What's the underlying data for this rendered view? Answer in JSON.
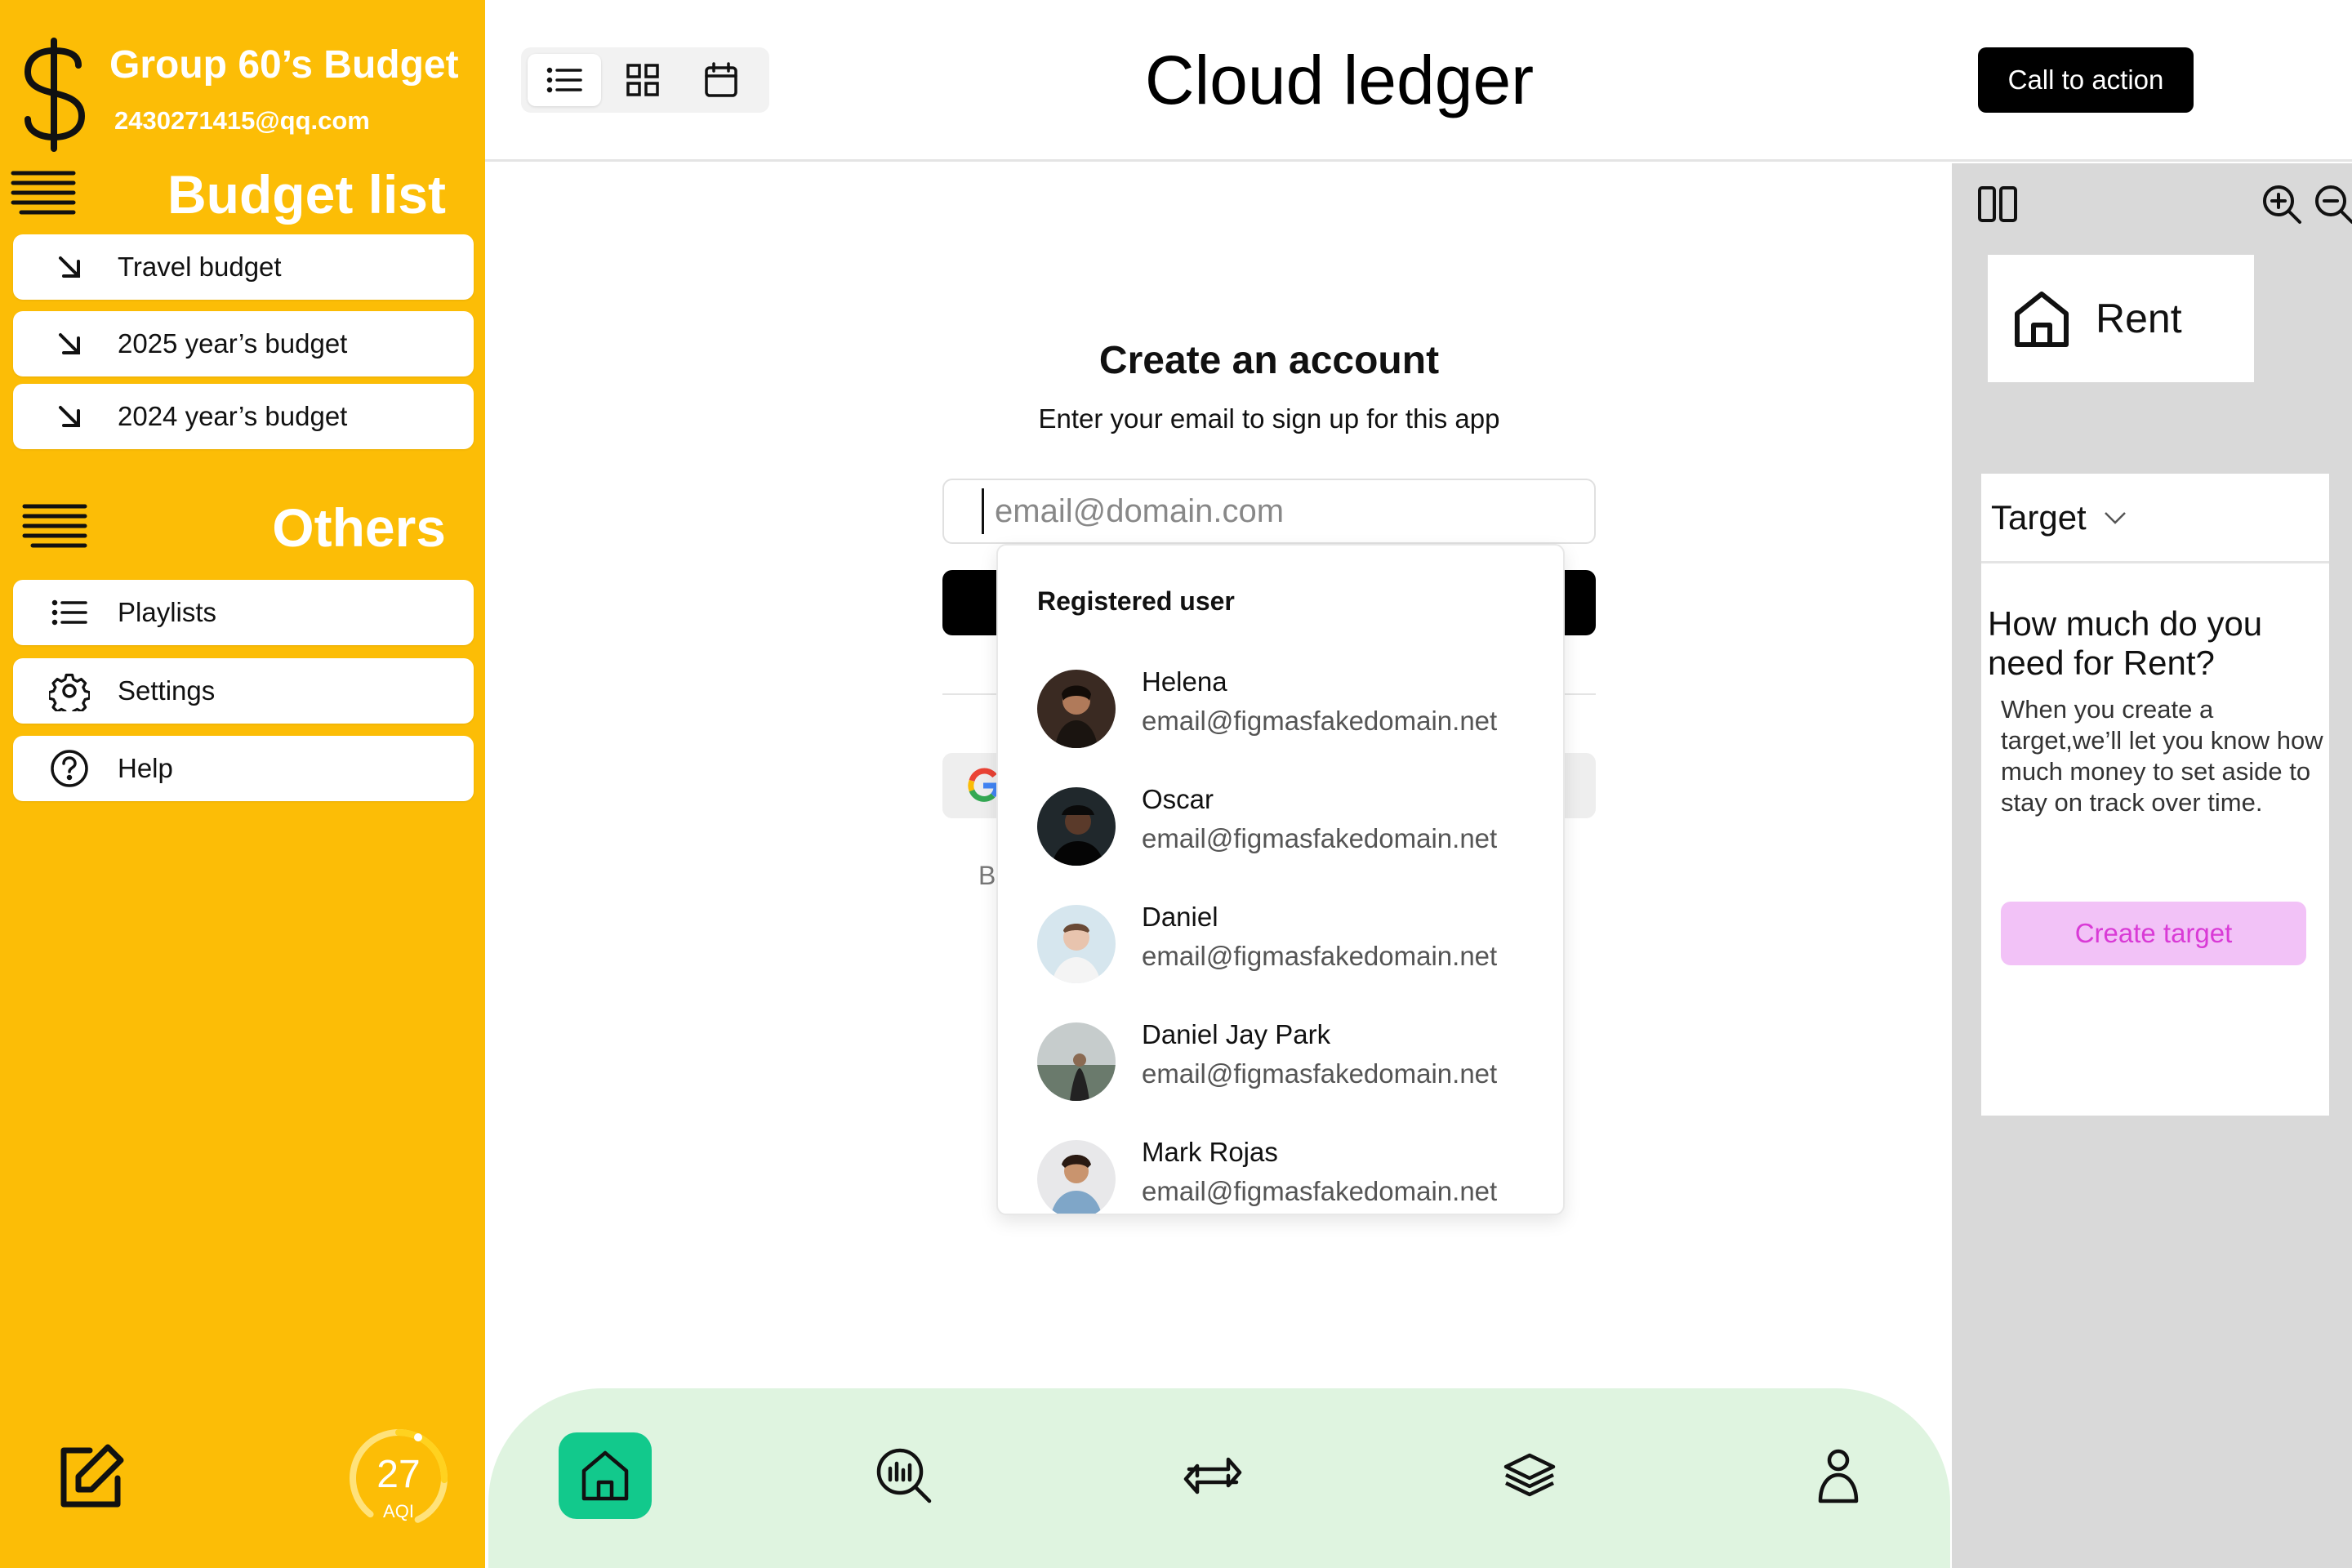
{
  "sidebar": {
    "brand_title": "Group 60’s Budget",
    "email": "2430271415@qq.com",
    "budget_section": "Budget list",
    "budget_items": [
      {
        "label": "Travel budget"
      },
      {
        "label": "2025 year’s budget"
      },
      {
        "label": "2024 year’s budget"
      }
    ],
    "others_section": "Others",
    "others_items": [
      {
        "label": "Playlists",
        "icon": "list-icon"
      },
      {
        "label": "Settings",
        "icon": "gear-icon"
      },
      {
        "label": "Help",
        "icon": "help-icon"
      }
    ],
    "aqi": {
      "value": "27",
      "label": "AQI",
      "level": 0.27
    }
  },
  "header": {
    "title": "Cloud ledger",
    "cta": "Call to action",
    "views": [
      "list-view-icon",
      "grid-view-icon",
      "calendar-view-icon"
    ],
    "active_view": "list"
  },
  "form": {
    "title": "Create an account",
    "subtitle": "Enter your email to sign up for this app",
    "email_placeholder": "email@domain.com",
    "legal_initial": "B"
  },
  "dropdown": {
    "header": "Registered user",
    "users": [
      {
        "name": "Helena",
        "email": "email@figmasfakedomain.net"
      },
      {
        "name": "Oscar",
        "email": "email@figmasfakedomain.net"
      },
      {
        "name": "Daniel",
        "email": "email@figmasfakedomain.net"
      },
      {
        "name": "Daniel Jay Park",
        "email": "email@figmasfakedomain.net"
      },
      {
        "name": "Mark Rojas",
        "email": "email@figmasfakedomain.net"
      }
    ]
  },
  "right_panel": {
    "category": "Rent",
    "target_label": "Target",
    "question": "How much do you need for Rent?",
    "description": "When you create a target,we’ll let you know how much money to set aside to stay on track over time.",
    "create_button": "Create target"
  },
  "bottom_nav": {
    "items": [
      "home-icon",
      "analytics-icon",
      "transfer-icon",
      "layers-icon",
      "profile-icon"
    ],
    "active": "home"
  },
  "colors": {
    "sidebar": "#FCBD06",
    "nav_bg": "#DFF4E0",
    "nav_active": "#12C98C",
    "target_button_bg": "#F2C2F7",
    "target_button_text": "#D93AD6"
  }
}
